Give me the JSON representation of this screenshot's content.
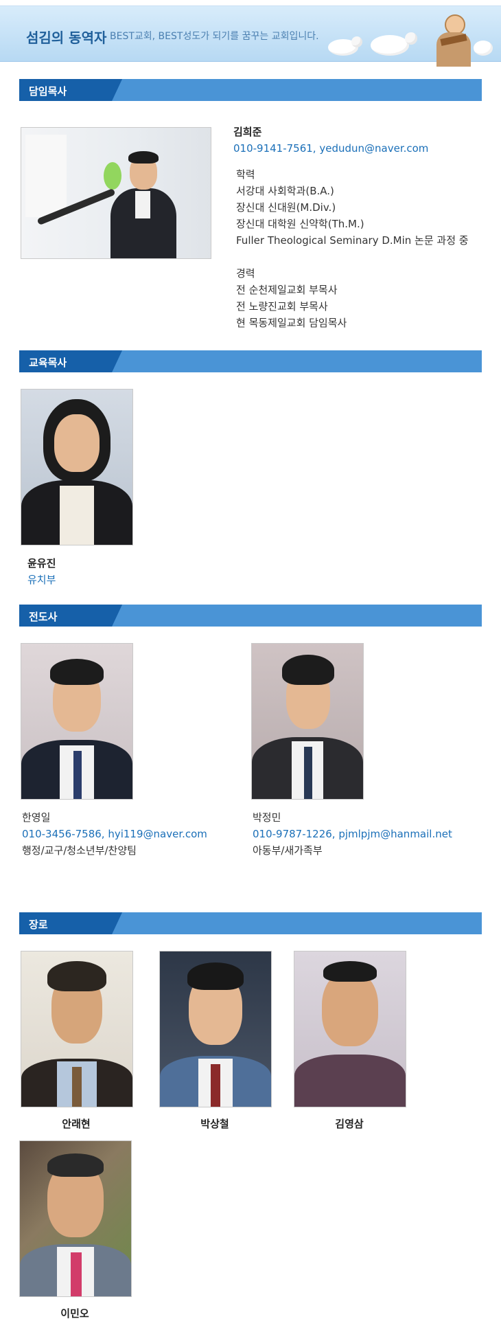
{
  "header": {
    "title": "섬김의 동역자",
    "subtitle": "BEST교회, BEST성도가 되기를 꿈꾸는 교회입니다."
  },
  "sections": {
    "senior": "담임목사",
    "education": "교육목사",
    "evangelist": "전도사",
    "elder": "장로"
  },
  "senior_pastor": {
    "name": "김희준",
    "contact": "010-9141-7561, yedudun@naver.com",
    "education_title": "학력",
    "education": [
      "서강대 사회학과(B.A.)",
      "장신대 신대원(M.Div.)",
      "장신대 대학원 신약학(Th.M.)",
      "Fuller Theological Seminary D.Min 논문 과정 중"
    ],
    "career_title": "경력",
    "career": [
      "전 순천제일교회 부목사",
      "전 노량진교회 부목사",
      "현 목동제일교회 담임목사"
    ]
  },
  "education_pastor": {
    "name": "윤유진",
    "dept": "유치부"
  },
  "evangelists": [
    {
      "name": "한영일",
      "contact": "010-3456-7586, hyi119@naver.com",
      "dept": "행정/교구/청소년부/찬양팀"
    },
    {
      "name": "박정민",
      "contact": "010-9787-1226, pjmlpjm@hanmail.net",
      "dept": "아동부/새가족부"
    }
  ],
  "elders": [
    "안래현",
    "박상철",
    "김영삼",
    "이민오"
  ],
  "colors": {
    "accent": "#1a6fb8",
    "bar_dark": "#1660a9",
    "bar_light": "#4a94d6"
  }
}
